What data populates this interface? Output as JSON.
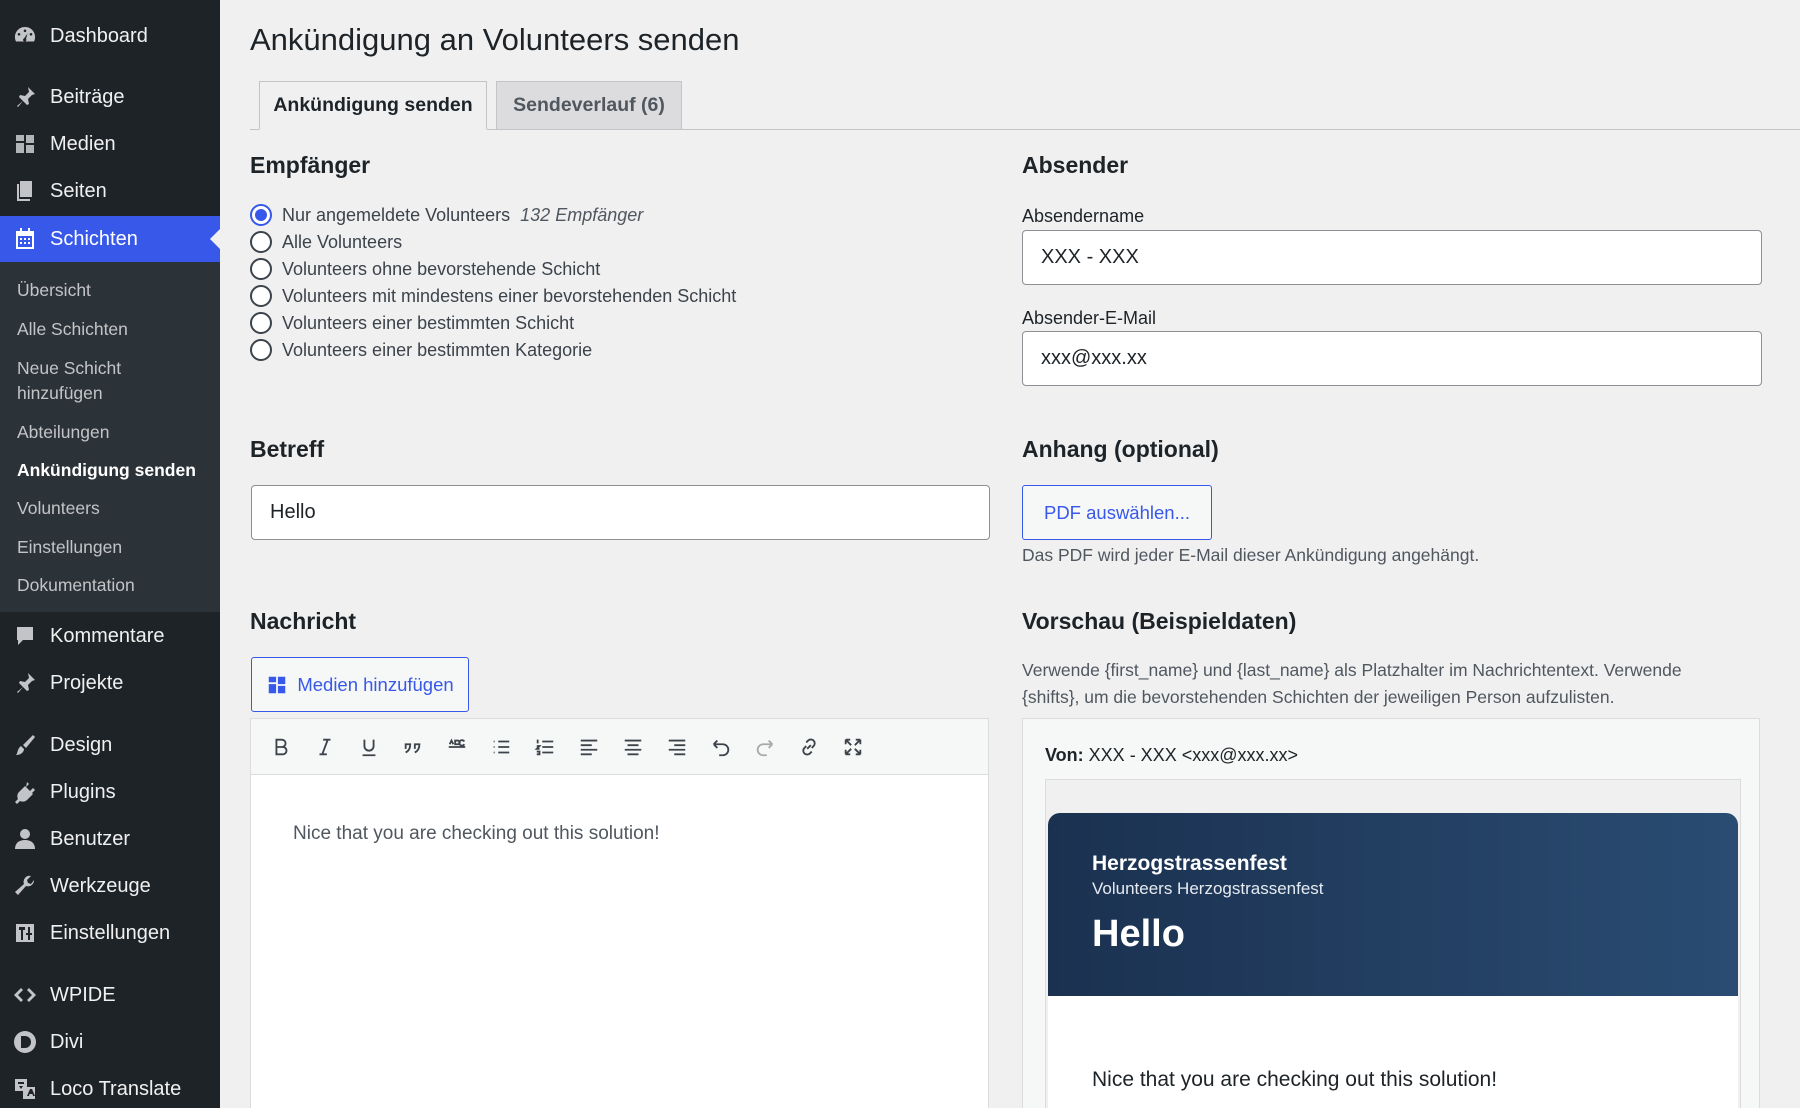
{
  "sidebar": {
    "items": [
      {
        "label": "Dashboard",
        "icon": "dashboard-icon"
      },
      {
        "label": "Beiträge",
        "icon": "pin-icon"
      },
      {
        "label": "Medien",
        "icon": "media-icon"
      },
      {
        "label": "Seiten",
        "icon": "pages-icon"
      },
      {
        "label": "Schichten",
        "icon": "calendar-icon"
      },
      {
        "label": "Kommentare",
        "icon": "comment-icon"
      },
      {
        "label": "Projekte",
        "icon": "pin-icon"
      },
      {
        "label": "Design",
        "icon": "brush-icon"
      },
      {
        "label": "Plugins",
        "icon": "plugin-icon"
      },
      {
        "label": "Benutzer",
        "icon": "user-icon"
      },
      {
        "label": "Werkzeuge",
        "icon": "wrench-icon"
      },
      {
        "label": "Einstellungen",
        "icon": "settings-icon"
      },
      {
        "label": "WPIDE",
        "icon": "code-icon"
      },
      {
        "label": "Divi",
        "icon": "divi-icon"
      },
      {
        "label": "Loco Translate",
        "icon": "translate-icon"
      }
    ],
    "submenu": [
      "Übersicht",
      "Alle Schichten",
      "Neue Schicht",
      "hinzufügen",
      "Abteilungen",
      "Ankündigung senden",
      "Volunteers",
      "Einstellungen",
      "Dokumentation"
    ]
  },
  "page": {
    "title": "Ankündigung an Volunteers senden",
    "tabs": [
      "Ankündigung senden",
      "Sendeverlauf (6)"
    ]
  },
  "recipients": {
    "heading": "Empfänger",
    "options": [
      "Nur angemeldete Volunteers",
      "Alle Volunteers",
      "Volunteers ohne bevorstehende Schicht",
      "Volunteers mit mindestens einer bevorstehenden Schicht",
      "Volunteers einer bestimmten Schicht",
      "Volunteers einer bestimmten Kategorie"
    ],
    "selected_count": "132 Empfänger"
  },
  "sender": {
    "heading": "Absender",
    "name_label": "Absendername",
    "name_value": "XXX - XXX",
    "email_label": "Absender-E-Mail",
    "email_value": "xxx@xxx.xx"
  },
  "subject": {
    "heading": "Betreff",
    "value": "Hello"
  },
  "attachment": {
    "heading": "Anhang (optional)",
    "button": "PDF auswählen...",
    "help": "Das PDF wird jeder E-Mail dieser Ankündigung angehängt."
  },
  "message": {
    "heading": "Nachricht",
    "add_media": "Medien hinzufügen",
    "body": "Nice that you are checking out this solution!",
    "toolbar": [
      "bold-icon",
      "italic-icon",
      "underline-icon",
      "quote-icon",
      "strikethrough-icon",
      "bullet-list-icon",
      "numbered-list-icon",
      "align-left-icon",
      "align-center-icon",
      "align-right-icon",
      "undo-icon",
      "redo-icon",
      "link-icon",
      "fullscreen-icon"
    ]
  },
  "preview": {
    "heading": "Vorschau (Beispieldaten)",
    "help_line1": "Verwende {first_name} und {last_name} als Platzhalter im Nachrichtentext. Verwende",
    "help_line2": "{shifts}, um die bevorstehenden Schichten der jeweiligen Person aufzulisten.",
    "from_label": "Von:",
    "from_value": "XXX - XXX <xxx@xxx.xx>",
    "org": "Herzogstrassenfest",
    "org_sub": "Volunteers Herzogstrassenfest",
    "subject": "Hello",
    "body": "Nice that you are checking out this solution!"
  },
  "colors": {
    "accent": "#3858e9",
    "sidebar": "#1d2327",
    "header_dark": "#1b3150"
  }
}
